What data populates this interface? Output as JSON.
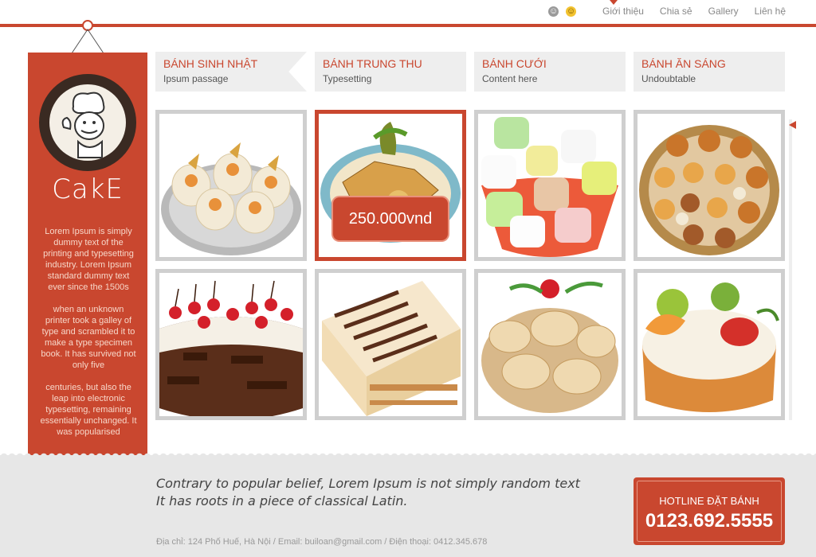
{
  "nav": {
    "icons": [
      "grey-face-icon",
      "smiley-face-icon"
    ],
    "items": [
      {
        "label": "Giới thiệu"
      },
      {
        "label": "Chia sẻ"
      },
      {
        "label": "Gallery"
      },
      {
        "label": "Liên hệ"
      }
    ]
  },
  "sidebar": {
    "brand": "CakE",
    "desc": [
      "Lorem Ipsum is simply dummy text of the printing and typesetting industry. Lorem Ipsum standard dummy text ever since the 1500s",
      "when an unknown printer took a galley of type and scrambled it to make a type specimen book. It has survived not only five",
      "centuries, but also the leap into electronic typesetting, remaining essentially unchanged. It was popularised"
    ]
  },
  "categories": [
    {
      "title": "BÁNH SINH NHẬT",
      "sub": "Ipsum passage"
    },
    {
      "title": "BÁNH TRUNG THU",
      "sub": "Typesetting"
    },
    {
      "title": "BÁNH CƯỚI",
      "sub": "Content here"
    },
    {
      "title": "BÁNH ĂN SÁNG",
      "sub": "Undoubtable"
    }
  ],
  "gallery": {
    "price": "250.000vnd",
    "items": [
      "cream-cake-cups",
      "mooncake-plate",
      "marshmallow-bowl",
      "bread-basket",
      "cherry-cake",
      "layer-cake",
      "cream-pastry",
      "fruit-cake"
    ]
  },
  "footer": {
    "quote_line1": "Contrary to popular belief, Lorem Ipsum is not simply random text",
    "quote_line2": "It has roots in a piece of classical Latin.",
    "address": "Địa chỉ: 124 Phố Huế, Hà Nội  /  Email: builoan@gmail.com  /  Điện thoại: 0412.345.678",
    "hotline_label": "HOTLINE ĐẶT BÁNH",
    "hotline_number": "0123.692.5555"
  },
  "colors": {
    "accent": "#c9472f",
    "panel": "#eeeeee",
    "footer": "#e7e7e7"
  }
}
